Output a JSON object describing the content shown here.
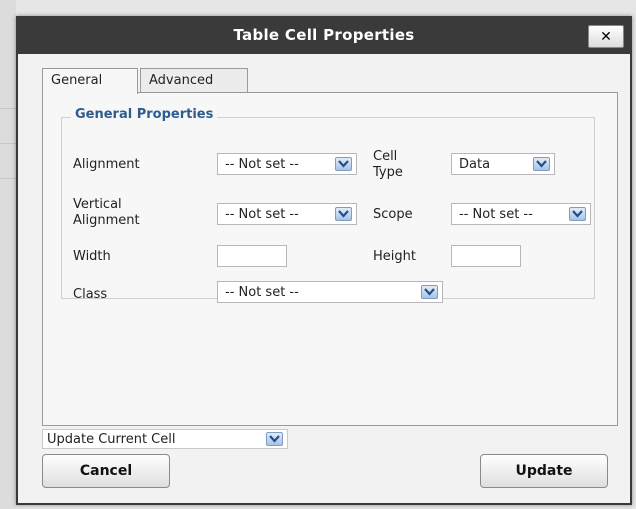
{
  "dialog": {
    "title": "Table Cell Properties",
    "close_label": "✕"
  },
  "tabs": [
    {
      "label": "General",
      "active": true
    },
    {
      "label": "Advanced",
      "active": false
    }
  ],
  "general": {
    "legend": "General Properties",
    "alignment": {
      "label": "Alignment",
      "value": "-- Not set --"
    },
    "cell_type": {
      "label_line1": "Cell",
      "label_line2": "Type",
      "value": "Data"
    },
    "vertical_alignment": {
      "label_line1": "Vertical",
      "label_line2": "Alignment",
      "value": "-- Not set --"
    },
    "scope": {
      "label": "Scope",
      "value": "-- Not set --"
    },
    "width": {
      "label": "Width",
      "value": ""
    },
    "height": {
      "label": "Height",
      "value": ""
    },
    "class": {
      "label": "Class",
      "value": "-- Not set --"
    }
  },
  "footer": {
    "action_select": "Update Current Cell",
    "cancel_label": "Cancel",
    "update_label": "Update"
  },
  "colors": {
    "titlebar": "#3a3a3a",
    "legend": "#2d5c8f",
    "dropdown_arrow": "#a9c3e4"
  }
}
